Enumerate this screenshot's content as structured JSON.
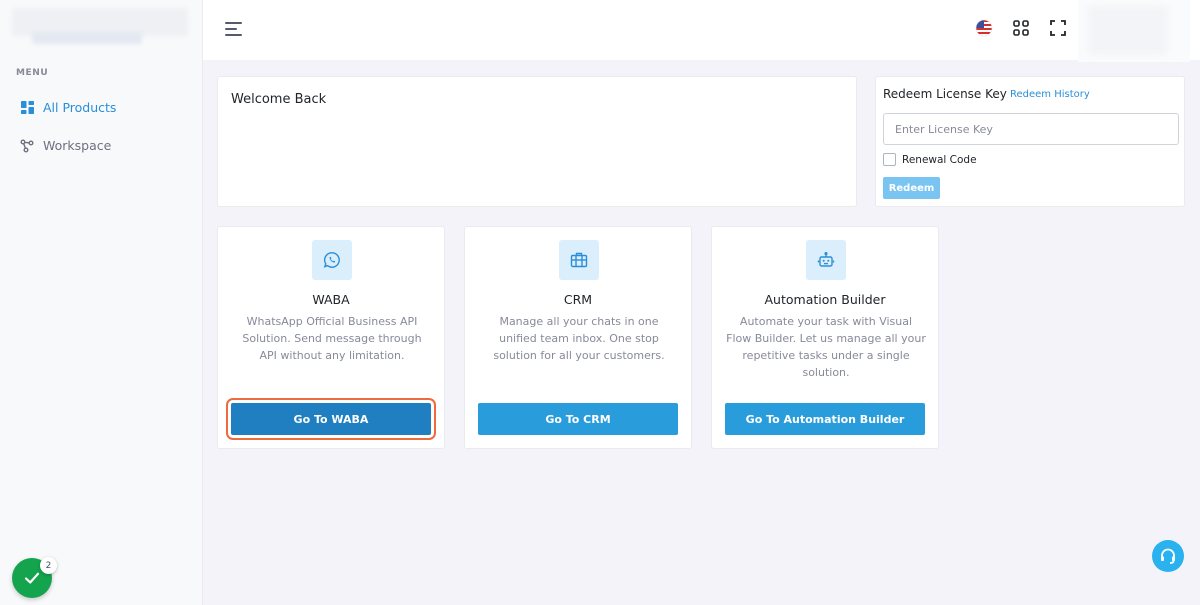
{
  "sidebar": {
    "menu_title": "MENU",
    "items": [
      {
        "label": "All Products",
        "icon": "grid-icon",
        "active": true
      },
      {
        "label": "Workspace",
        "icon": "share-nodes-icon",
        "active": false
      }
    ]
  },
  "topbar": {
    "icons": [
      "menu-toggle-icon",
      "us-flag-icon",
      "apps-grid-icon",
      "fullscreen-icon"
    ]
  },
  "welcome": {
    "title": "Welcome Back"
  },
  "redeem": {
    "title": "Redeem License Key",
    "history_link": "Redeem History",
    "input_placeholder": "Enter License Key",
    "input_value": "",
    "renewal_label": "Renewal Code",
    "renewal_checked": false,
    "button_label": "Redeem"
  },
  "products": [
    {
      "title": "WABA",
      "icon": "whatsapp-icon",
      "description": "WhatsApp Official Business API Solution. Send message through API without any limitation.",
      "button_label": "Go To WABA"
    },
    {
      "title": "CRM",
      "icon": "briefcase-icon",
      "description": "Manage all your chats in one unified team inbox. One stop solution for all your customers.",
      "button_label": "Go To CRM"
    },
    {
      "title": "Automation Builder",
      "icon": "robot-icon",
      "description": "Automate your task with Visual Flow Builder. Let us manage all your repetitive tasks under a single solution.",
      "button_label": "Go To Automation Builder"
    }
  ],
  "floating": {
    "checklist_badge": "2",
    "help_icon": "headset-icon"
  },
  "colors": {
    "primary": "#299cdb",
    "primary_active": "#1f7fc0",
    "focus_ring": "#ef6a3c",
    "success": "#14a44d",
    "help": "#2ab2ef"
  }
}
